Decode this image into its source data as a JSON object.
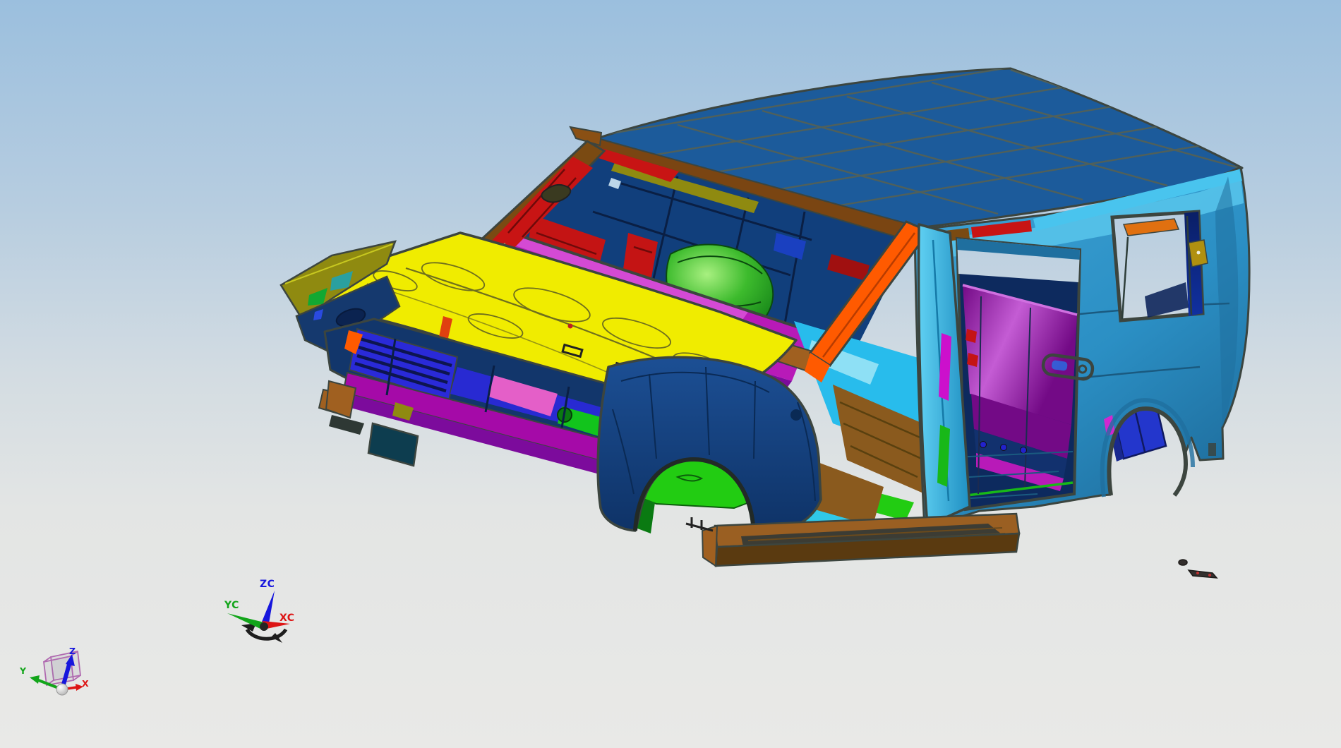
{
  "viewport": {
    "type": "cad-3d-viewport",
    "content": "automotive body-in-white assembly, multi-colored panels, isometric view"
  },
  "wcs_triad": {
    "z_label": "ZC",
    "y_label": "YC",
    "x_label": "XC"
  },
  "datum_csys": {
    "z_label": "Z",
    "y_label": "Y",
    "x_label": "X"
  },
  "palette": {
    "bg_top": "#9bbfde",
    "bg_upper": "#b7cde0",
    "bg_mid": "#d3dce2",
    "bg_lower": "#e3e5e4",
    "bg_bottom": "#e9e9e7",
    "edge": "#3c453f",
    "roof": "#1c5b9b",
    "roof_line": "#50605a",
    "header_brown": "#7a4512",
    "spoiler_brown": "#8a5014",
    "drip_cyan": "#49c4ee",
    "rail_red": "#c81414",
    "rail_brown": "#7a4a12",
    "body_teal": "#2b8fc4",
    "body_teal_dark": "#1f6f9f",
    "body_teal_light": "#57c3ea",
    "pillar_orange": "#ff5a00",
    "hood_yellow": "#f0ec00",
    "hood_line": "#6f6f1d",
    "fender_navy_top": "#1c4f94",
    "fender_navy": "#0e3266",
    "grille_blue": "#2a2ad8",
    "grille_slot": "#0d1550",
    "bumper_magenta": "#a50aa8",
    "lower_purple": "#7c0b9c",
    "pink": "#e45fc8",
    "fascia_navy": "#12366b",
    "bright_green": "#22cc12",
    "green_dark": "#0a7a12",
    "lime": "#7ae838",
    "dome_light": "#a8f080",
    "dome_mid": "#3dbb2d",
    "dome_dark": "#0e7a14",
    "floor_brown": "#8a5a1e",
    "board_brown": "#9a5f22",
    "board_dark": "#3c3c34",
    "floor_cyan": "#28bcec",
    "floor_cyan_light": "#b0ecf8",
    "dash_navy": "#113f7c",
    "deep_navy": "#0d2a5e",
    "int_red": "#c41414",
    "cowl_magenta": "#b81ab8",
    "seat_purple_dark": "#730a86",
    "seat_purple_light": "#c45cd4",
    "wheelhouse_blue": "#2336cc",
    "wheelhouse_navy": "#18288f",
    "olive": "#8f8a10",
    "gold_olive": "#b09010",
    "copper": "#a06020",
    "bolt_blue": "#2222cc",
    "teal_patch": "#2aa0a0",
    "air_dam": "#0d3d4f",
    "orange_shelf": "#e07010",
    "wcs_blue": "#1616dd",
    "wcs_green": "#12a51a",
    "wcs_red": "#dd1515",
    "wcs_dark": "#1d1d1d",
    "cube_purple": "#b06ab0",
    "sphere_hi": "#ffffff",
    "sphere_lo": "#a8a8a8",
    "debris": "#332f2d"
  }
}
